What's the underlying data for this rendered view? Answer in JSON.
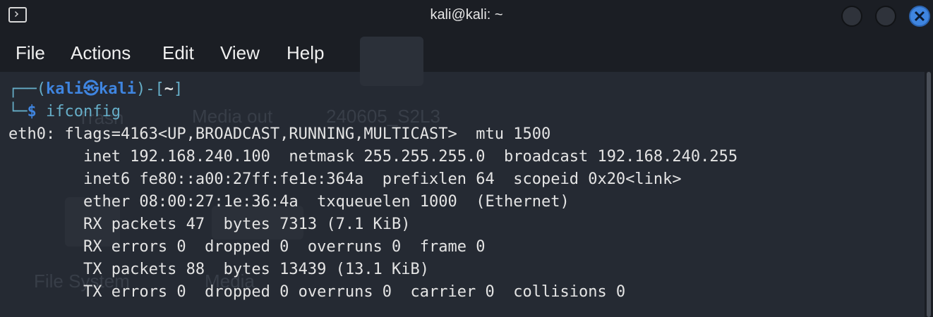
{
  "window": {
    "title": "kali@kali: ~"
  },
  "menu": [
    "File",
    "Actions",
    "Edit",
    "View",
    "Help"
  ],
  "prompt": {
    "corner_top": "┌──(",
    "user": "kali",
    "at_symbol": "㉿",
    "host": "kali",
    "mid": ")-[",
    "cwd": "~",
    "end": "]",
    "corner_bottom": "└─",
    "dollar": "$",
    "command": "ifconfig"
  },
  "output": [
    "eth0: flags=4163<UP,BROADCAST,RUNNING,MULTICAST>  mtu 1500",
    "        inet 192.168.240.100  netmask 255.255.255.0  broadcast 192.168.240.255",
    "        inet6 fe80::a00:27ff:fe1e:364a  prefixlen 64  scopeid 0x20<link>",
    "        ether 08:00:27:1e:36:4a  txqueuelen 1000  (Ethernet)",
    "        RX packets 47  bytes 7313 (7.1 KiB)",
    "        RX errors 0  dropped 0  overruns 0  frame 0",
    "        TX packets 88  bytes 13439 (13.1 KiB)",
    "        TX errors 0  dropped 0 overruns 0  carrier 0  collisions 0"
  ],
  "background_labels": [
    "Media out",
    "240605_S2L3",
    "Trash",
    "File System",
    "Media"
  ],
  "colors": {
    "accent_blue": "#3f85e0",
    "prompt_cyan": "#66aec8",
    "text": "#e4e4e4",
    "terminal_bg": "#232730"
  }
}
